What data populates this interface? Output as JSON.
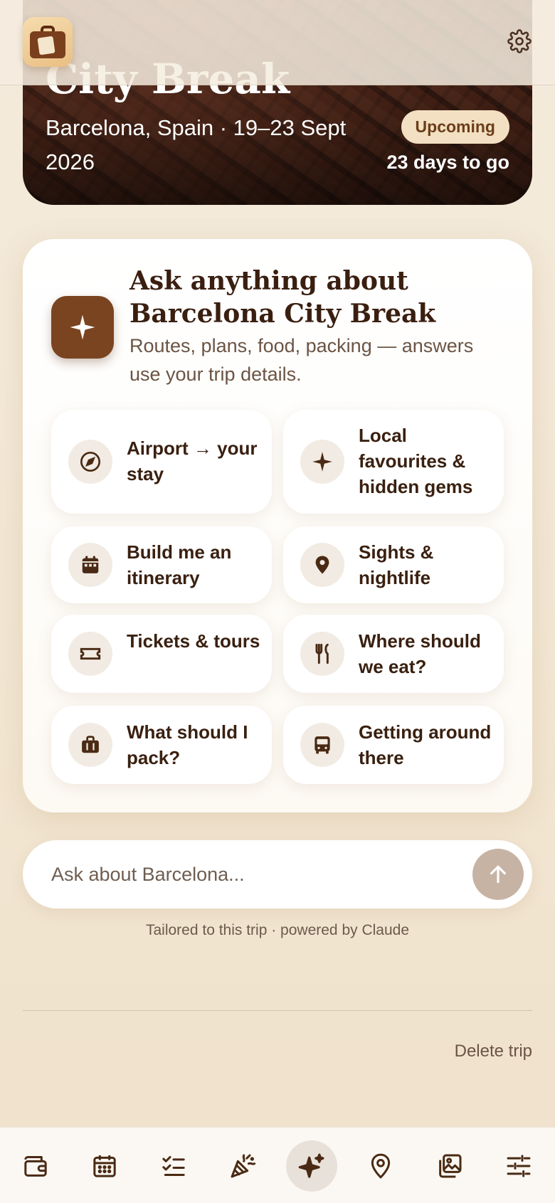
{
  "trip": {
    "title": "City Break",
    "subtitle": "Barcelona, Spain · 19–23 Sept 2026",
    "status": "Upcoming",
    "countdown": "23 days to go"
  },
  "topbar": {
    "logo_icon": "suitcase-logo-icon",
    "settings_icon": "gear-icon"
  },
  "ask": {
    "title": "Ask anything about Barcelona City Break",
    "description": "Routes, plans, food, packing — answers use your trip details.",
    "icon": "sparkle-icon",
    "suggestions": [
      {
        "label": "Airport → your stay",
        "icon": "compass-icon"
      },
      {
        "label": "Local favourites & hidden gems",
        "icon": "sparkle-icon"
      },
      {
        "label": "Build me an itinerary",
        "icon": "calendar-icon"
      },
      {
        "label": "Sights & nightlife",
        "icon": "map-pin-icon"
      },
      {
        "label": "Tickets & tours",
        "icon": "ticket-icon"
      },
      {
        "label": "Where should we eat?",
        "icon": "fork-knife-icon"
      },
      {
        "label": "What should I pack?",
        "icon": "briefcase-icon"
      },
      {
        "label": "Getting around there",
        "icon": "bus-icon"
      }
    ],
    "input_placeholder": "Ask about Barcelona...",
    "send_icon": "arrow-up-icon",
    "footer": "Tailored to this trip · powered by Claude"
  },
  "delete_trip": "Delete trip",
  "bottom_nav": [
    {
      "icon": "wallet-icon",
      "active": false
    },
    {
      "icon": "calendar-icon",
      "active": false
    },
    {
      "icon": "checklist-icon",
      "active": false
    },
    {
      "icon": "party-popper-icon",
      "active": false
    },
    {
      "icon": "sparkles-icon",
      "active": true
    },
    {
      "icon": "map-pin-icon",
      "active": false
    },
    {
      "icon": "photos-icon",
      "active": false
    },
    {
      "icon": "sliders-icon",
      "active": false
    }
  ],
  "colors": {
    "accent": "#7a4420",
    "background": "#f4ebdc",
    "badge_bg": "#f3e0c2",
    "send_button": "#c7b3a4"
  }
}
